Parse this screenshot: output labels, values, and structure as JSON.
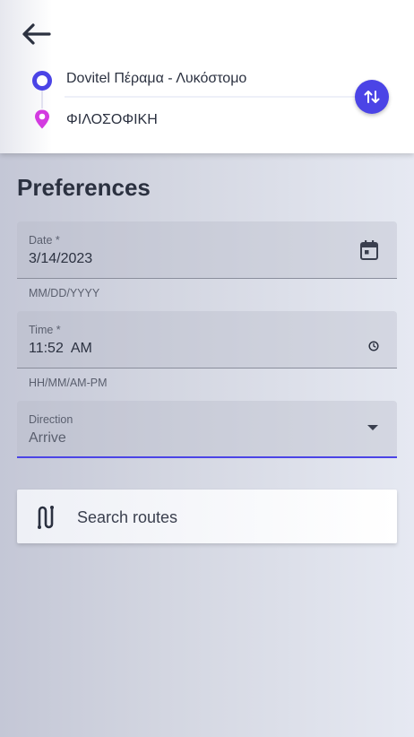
{
  "route": {
    "origin": "Dovitel Πέραμα - Λυκόστομο",
    "destination": "ΦΙΛΟΣΟΦΙΚΗ"
  },
  "preferences": {
    "title": "Preferences",
    "date": {
      "label": "Date *",
      "value": "3/14/2023",
      "helper": "MM/DD/YYYY"
    },
    "time": {
      "label": "Time *",
      "value": "11:52  AM",
      "helper": "HH/MM/AM-PM"
    },
    "direction": {
      "label": "Direction",
      "value": "Arrive"
    }
  },
  "actions": {
    "search_routes": "Search routes"
  },
  "colors": {
    "accent": "#4b44e6",
    "pin": "#d33be0",
    "text": "#2b3140"
  },
  "icons": {
    "back": "arrow-left-icon",
    "origin": "origin-circle-icon",
    "destination": "location-pin-icon",
    "swap": "swap-vertical-icon",
    "calendar": "calendar-icon",
    "clock": "clock-icon",
    "dropdown": "chevron-down-icon",
    "route": "route-icon"
  }
}
